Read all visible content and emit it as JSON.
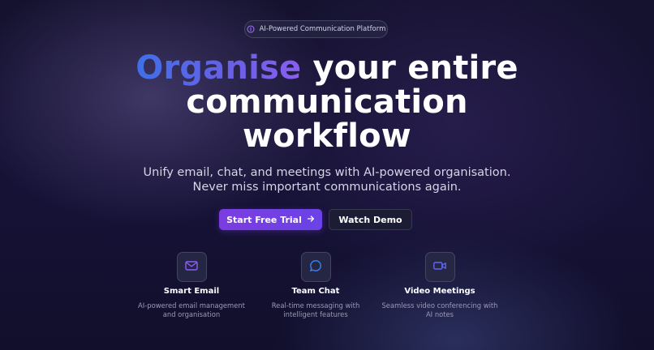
{
  "badge": {
    "label": "AI-Powered Communication Platform",
    "icon": "info-icon"
  },
  "hero": {
    "headline_accent": "Organise",
    "headline_line1_rest": " your entire",
    "headline_line2": "communication",
    "headline_line3": "workflow",
    "subtitle_line1": "Unify email, chat, and meetings with AI-powered organisation.",
    "subtitle_line2": "Never miss important communications again."
  },
  "cta": {
    "primary_label": "Start Free Trial",
    "primary_icon": "arrow-right-icon",
    "secondary_label": "Watch Demo"
  },
  "features": [
    {
      "title": "Smart Email",
      "desc_line1": "AI-powered email management",
      "desc_line2": "and organisation",
      "icon": "mail-icon",
      "icon_color": "#8b5cf6"
    },
    {
      "title": "Team Chat",
      "desc_line1": "Real-time messaging with",
      "desc_line2": "intelligent features",
      "icon": "chat-bubble-icon",
      "icon_color": "#3b82f6"
    },
    {
      "title": "Video Meetings",
      "desc_line1": "Seamless video conferencing with",
      "desc_line2": "AI notes",
      "icon": "video-camera-icon",
      "icon_color": "#6366f1"
    }
  ],
  "colors": {
    "background": "#120f2b",
    "accent_blue": "#3f6fe8",
    "accent_purple": "#7b3de0"
  }
}
